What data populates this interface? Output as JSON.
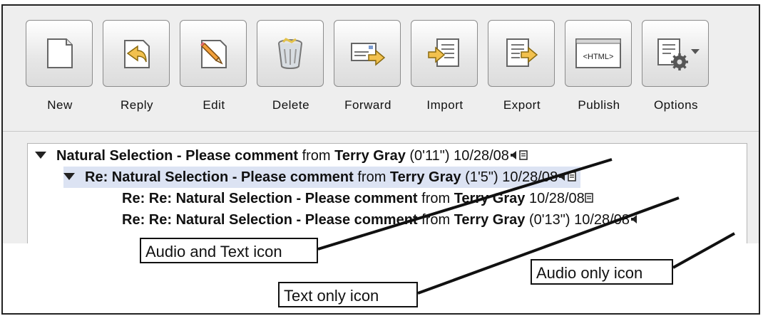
{
  "toolbar": {
    "buttons": [
      {
        "label": "New",
        "icon": "new-document-icon"
      },
      {
        "label": "Reply",
        "icon": "reply-icon"
      },
      {
        "label": "Edit",
        "icon": "edit-pencil-icon"
      },
      {
        "label": "Delete",
        "icon": "trash-bin-icon"
      },
      {
        "label": "Forward",
        "icon": "forward-icon"
      },
      {
        "label": "Import",
        "icon": "import-icon"
      },
      {
        "label": "Export",
        "icon": "export-icon"
      },
      {
        "label": "Publish",
        "icon": "html-publish-icon",
        "badge": "<HTML>"
      },
      {
        "label": "Options",
        "icon": "options-gear-icon"
      }
    ]
  },
  "thread": {
    "rows": [
      {
        "title": "Natural Selection - Please comment",
        "from_word": "from",
        "author": "Terry Gray",
        "duration": "(0'11\")",
        "date": "10/28/08",
        "icons": "audio-and-text",
        "expanded": true,
        "selected": false
      },
      {
        "title": "Re: Natural Selection - Please comment",
        "from_word": "from",
        "author": "Terry Gray",
        "duration": "(1'5\")",
        "date": "10/28/08",
        "icons": "audio-and-text",
        "expanded": true,
        "selected": true
      },
      {
        "title": "Re: Re: Natural Selection - Please comment",
        "from_word": "from",
        "author": "Terry Gray",
        "duration": "",
        "date": "10/28/08",
        "icons": "text-only",
        "expanded": false,
        "selected": false
      },
      {
        "title": "Re: Re: Natural Selection - Please comment",
        "from_word": "from",
        "author": "Terry Gray",
        "duration": "(0'13\")",
        "date": "10/28/08",
        "icons": "audio-only",
        "expanded": false,
        "selected": false
      }
    ]
  },
  "callouts": {
    "audio_and_text": "Audio and Text icon",
    "text_only": "Text only icon",
    "audio_only": "Audio only icon"
  },
  "colors": {
    "selection": "#dce3f3",
    "toolbar_bg": "#eeeeee",
    "arrow_yellow": "#f2c14e"
  }
}
